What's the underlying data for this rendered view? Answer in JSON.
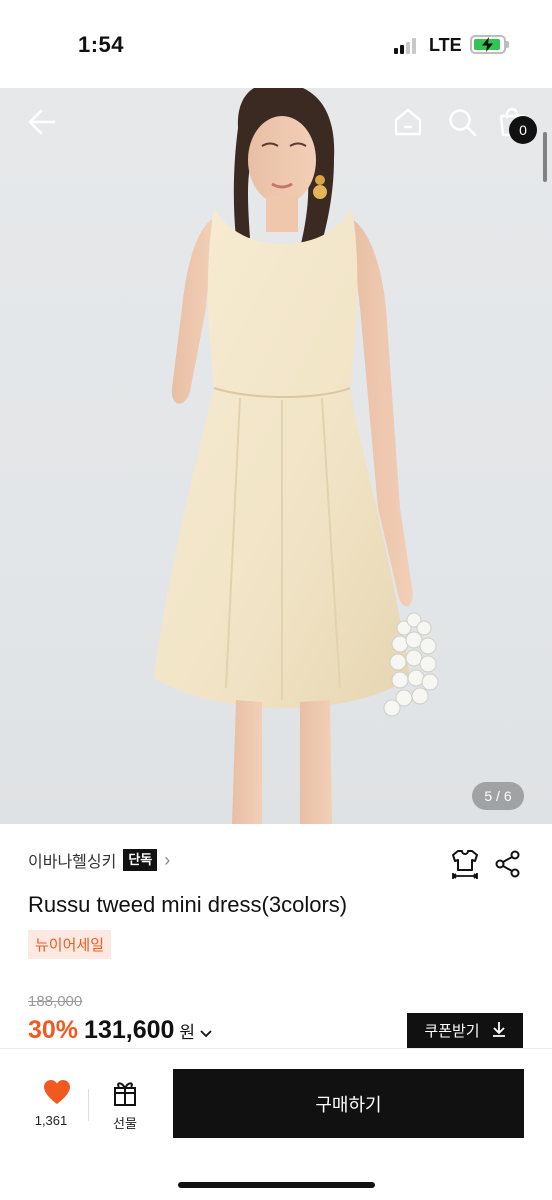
{
  "status_bar": {
    "time": "1:54",
    "network": "LTE",
    "signal_bars_active": 2,
    "signal_bars_total": 4,
    "battery_charging": true
  },
  "gallery": {
    "page_indicator": "5 / 6",
    "current_page": 5,
    "total_pages": 6,
    "cart_count": "0",
    "icons": [
      "back-arrow-icon",
      "home-icon",
      "search-icon",
      "shopping-bag-icon"
    ]
  },
  "product": {
    "brand": "이바나헬싱키",
    "exclusive_badge": "단독",
    "title": "Russu tweed mini dress(3colors)",
    "sale_tag": "뉴이어세일",
    "original_price": "188,000",
    "discount_rate": "30%",
    "sale_price": "131,600",
    "currency": "원",
    "coupon_button": "쿠폰받기"
  },
  "bottom_bar": {
    "like_count": "1,361",
    "gift_label": "선물",
    "buy_label": "구매하기"
  },
  "colors": {
    "accent": "#f05a22",
    "accent_soft_bg": "#fde9e1",
    "primary_dark": "#111111",
    "charging_green": "#31c553"
  }
}
